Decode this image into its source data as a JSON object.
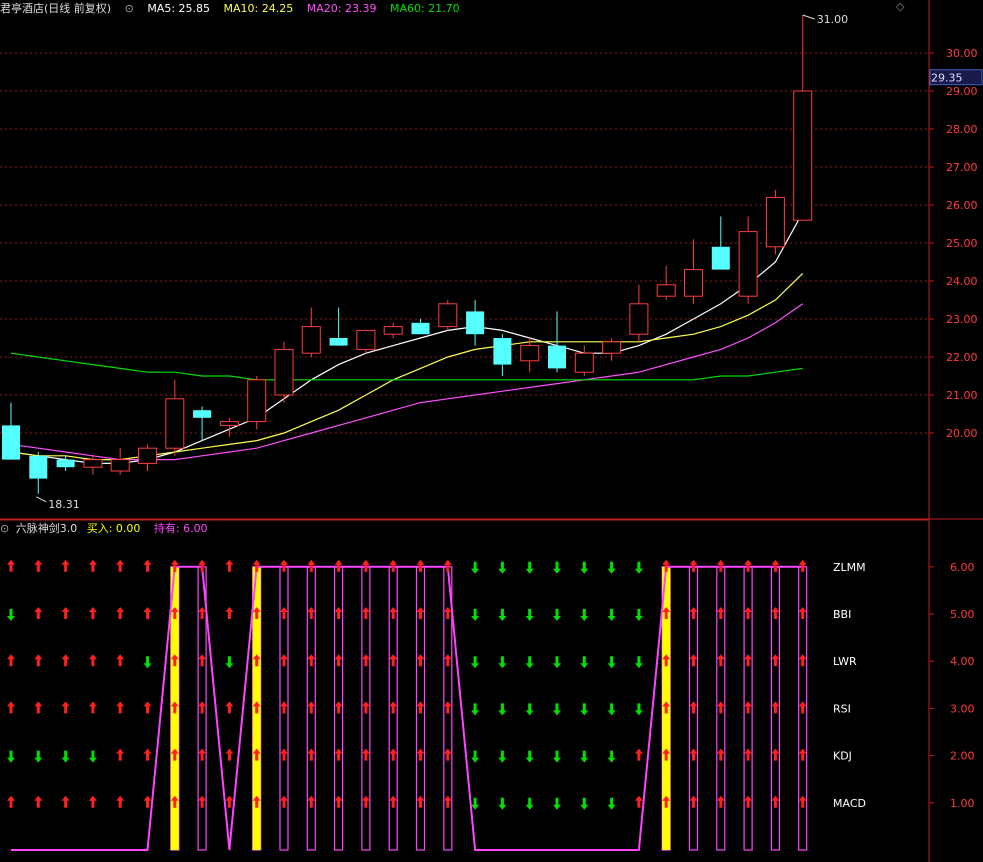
{
  "header": {
    "title": "君亭酒店(日线 前复权)",
    "ma5_label": "MA5: 25.85",
    "ma10_label": "MA10: 24.25",
    "ma20_label": "MA20: 23.39",
    "ma60_label": "MA60: 21.70"
  },
  "indicator_header": {
    "name": "六脉神剑3.0",
    "buy_label": "买入: 0.00",
    "hold_label": "持有: 6.00"
  },
  "price_scale": {
    "ticks": [
      "30.00",
      "29.00",
      "28.00",
      "27.00",
      "26.00",
      "25.00",
      "24.00",
      "23.00",
      "22.00",
      "21.00",
      "20.00"
    ],
    "current_price": "29.35"
  },
  "annotations": {
    "high": "31.00",
    "low": "18.31"
  },
  "colors": {
    "up": "#ff3c3c",
    "down": "#54ffff",
    "ma5": "#ffffff",
    "ma10": "#ffff4f",
    "ma20": "#ff4fff",
    "ma60": "#00e000",
    "grid": "#8b1a1a",
    "hold": "#ff44ff",
    "buy": "#ffff00",
    "arrow_up": "#ff2020",
    "arrow_down": "#00e000"
  },
  "chart_data": [
    {
      "type": "candlestick",
      "title": "君亭酒店(日线 前复权)",
      "ylim": [
        19.2,
        31.2
      ],
      "candles": [
        {
          "o": 20.2,
          "h": 20.8,
          "l": 19.4,
          "c": 19.3
        },
        {
          "o": 19.4,
          "h": 19.5,
          "l": 18.4,
          "c": 18.8
        },
        {
          "o": 19.3,
          "h": 19.4,
          "l": 19.0,
          "c": 19.1
        },
        {
          "o": 19.1,
          "h": 19.4,
          "l": 18.9,
          "c": 19.3
        },
        {
          "o": 19.0,
          "h": 19.6,
          "l": 18.9,
          "c": 19.3
        },
        {
          "o": 19.2,
          "h": 19.7,
          "l": 19.0,
          "c": 19.6
        },
        {
          "o": 19.6,
          "h": 21.4,
          "l": 19.4,
          "c": 20.9
        },
        {
          "o": 20.6,
          "h": 20.7,
          "l": 19.8,
          "c": 20.4
        },
        {
          "o": 20.2,
          "h": 20.4,
          "l": 19.9,
          "c": 20.3
        },
        {
          "o": 20.3,
          "h": 21.5,
          "l": 20.1,
          "c": 21.4
        },
        {
          "o": 21.0,
          "h": 22.4,
          "l": 20.8,
          "c": 22.2
        },
        {
          "o": 22.1,
          "h": 23.3,
          "l": 22.0,
          "c": 22.8
        },
        {
          "o": 22.5,
          "h": 23.3,
          "l": 22.3,
          "c": 22.3
        },
        {
          "o": 22.2,
          "h": 22.7,
          "l": 22.1,
          "c": 22.7
        },
        {
          "o": 22.6,
          "h": 22.9,
          "l": 22.5,
          "c": 22.8
        },
        {
          "o": 22.9,
          "h": 23.0,
          "l": 22.6,
          "c": 22.6
        },
        {
          "o": 22.8,
          "h": 23.5,
          "l": 22.7,
          "c": 23.4
        },
        {
          "o": 23.2,
          "h": 23.5,
          "l": 22.3,
          "c": 22.6
        },
        {
          "o": 22.5,
          "h": 22.6,
          "l": 21.5,
          "c": 21.8
        },
        {
          "o": 21.9,
          "h": 22.5,
          "l": 21.6,
          "c": 22.3
        },
        {
          "o": 22.3,
          "h": 23.2,
          "l": 21.6,
          "c": 21.7
        },
        {
          "o": 21.6,
          "h": 22.3,
          "l": 21.5,
          "c": 22.1
        },
        {
          "o": 22.1,
          "h": 22.5,
          "l": 21.9,
          "c": 22.4
        },
        {
          "o": 22.6,
          "h": 23.9,
          "l": 22.4,
          "c": 23.4
        },
        {
          "o": 23.6,
          "h": 24.4,
          "l": 23.5,
          "c": 23.9
        },
        {
          "o": 23.6,
          "h": 25.1,
          "l": 23.4,
          "c": 24.3
        },
        {
          "o": 24.9,
          "h": 25.7,
          "l": 24.3,
          "c": 24.3
        },
        {
          "o": 23.6,
          "h": 25.7,
          "l": 23.4,
          "c": 25.3
        },
        {
          "o": 24.9,
          "h": 26.4,
          "l": 24.7,
          "c": 26.2
        },
        {
          "o": 25.6,
          "h": 31.0,
          "l": 25.6,
          "c": 29.0
        }
      ],
      "ma_lines": [
        {
          "name": "MA5",
          "values": [
            19.5,
            19.4,
            19.3,
            19.2,
            19.2,
            19.3,
            19.5,
            19.8,
            20.1,
            20.4,
            20.9,
            21.4,
            21.8,
            22.1,
            22.3,
            22.5,
            22.7,
            22.8,
            22.7,
            22.5,
            22.3,
            22.1,
            22.1,
            22.3,
            22.6,
            23.0,
            23.4,
            23.9,
            24.5,
            25.8
          ]
        },
        {
          "name": "MA10",
          "values": [
            19.5,
            19.4,
            19.4,
            19.3,
            19.3,
            19.4,
            19.5,
            19.6,
            19.7,
            19.8,
            20.0,
            20.3,
            20.6,
            21.0,
            21.4,
            21.7,
            22.0,
            22.2,
            22.3,
            22.4,
            22.4,
            22.4,
            22.4,
            22.4,
            22.5,
            22.6,
            22.8,
            23.1,
            23.5,
            24.2
          ]
        },
        {
          "name": "MA20",
          "values": [
            19.7,
            19.6,
            19.5,
            19.4,
            19.3,
            19.3,
            19.3,
            19.4,
            19.5,
            19.6,
            19.8,
            20.0,
            20.2,
            20.4,
            20.6,
            20.8,
            20.9,
            21.0,
            21.1,
            21.2,
            21.3,
            21.4,
            21.5,
            21.6,
            21.8,
            22.0,
            22.2,
            22.5,
            22.9,
            23.4
          ]
        },
        {
          "name": "MA60",
          "values": [
            22.1,
            22.0,
            21.9,
            21.8,
            21.7,
            21.6,
            21.6,
            21.5,
            21.5,
            21.4,
            21.4,
            21.4,
            21.4,
            21.4,
            21.4,
            21.4,
            21.4,
            21.4,
            21.4,
            21.4,
            21.4,
            21.4,
            21.4,
            21.4,
            21.4,
            21.4,
            21.5,
            21.5,
            21.6,
            21.7
          ]
        }
      ]
    },
    {
      "type": "line",
      "title": "六脉神剑3.0",
      "ylim": [
        0,
        6.5
      ],
      "y_ticks": [
        "6.00",
        "5.00",
        "4.00",
        "3.00",
        "2.00",
        "1.00"
      ],
      "row_labels": [
        "ZLMM",
        "BBI",
        "LWR",
        "RSI",
        "KDJ",
        "MACD"
      ],
      "series": [
        {
          "name": "持有",
          "values": [
            0,
            0,
            0,
            0,
            0,
            0,
            6,
            6,
            0,
            6,
            6,
            6,
            6,
            6,
            6,
            6,
            6,
            0,
            0,
            0,
            0,
            0,
            0,
            0,
            6,
            6,
            6,
            6,
            6,
            6
          ]
        },
        {
          "name": "买入",
          "values": [
            0,
            0,
            0,
            0,
            0,
            0,
            6,
            0,
            0,
            6,
            0,
            0,
            0,
            0,
            0,
            0,
            0,
            0,
            0,
            0,
            0,
            0,
            0,
            0,
            6,
            0,
            0,
            0,
            0,
            0
          ]
        }
      ],
      "signals": [
        [
          1,
          1,
          1,
          1,
          1,
          1,
          1,
          1,
          1,
          1,
          1,
          1,
          1,
          1,
          1,
          1,
          1,
          0,
          0,
          0,
          0,
          0,
          0,
          0,
          1,
          1,
          1,
          1,
          1,
          1
        ],
        [
          0,
          1,
          1,
          1,
          1,
          1,
          1,
          1,
          1,
          1,
          1,
          1,
          1,
          1,
          1,
          1,
          1,
          0,
          0,
          0,
          0,
          0,
          0,
          0,
          1,
          1,
          1,
          1,
          1,
          1
        ],
        [
          1,
          1,
          1,
          1,
          1,
          0,
          1,
          1,
          0,
          1,
          1,
          1,
          1,
          1,
          1,
          1,
          1,
          0,
          0,
          0,
          0,
          0,
          0,
          0,
          1,
          1,
          1,
          1,
          1,
          1
        ],
        [
          1,
          1,
          1,
          1,
          1,
          1,
          1,
          1,
          1,
          1,
          1,
          1,
          1,
          1,
          1,
          1,
          1,
          0,
          0,
          0,
          0,
          0,
          0,
          0,
          1,
          1,
          1,
          1,
          1,
          1
        ],
        [
          0,
          0,
          0,
          0,
          1,
          1,
          1,
          1,
          1,
          1,
          1,
          1,
          1,
          1,
          1,
          1,
          1,
          0,
          0,
          0,
          0,
          0,
          0,
          1,
          1,
          1,
          1,
          1,
          1,
          1
        ],
        [
          1,
          1,
          1,
          1,
          1,
          1,
          1,
          1,
          1,
          1,
          1,
          1,
          1,
          1,
          1,
          1,
          1,
          0,
          0,
          0,
          0,
          0,
          0,
          1,
          1,
          1,
          1,
          1,
          1,
          1
        ]
      ]
    }
  ]
}
